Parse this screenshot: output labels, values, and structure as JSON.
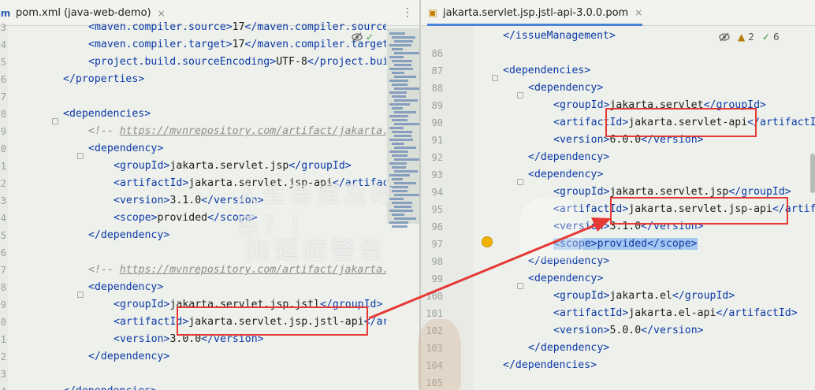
{
  "left_tab": {
    "title": "pom.xml (java-web-demo)",
    "icon": "maven-file-icon",
    "close_label": "×"
  },
  "right_tab": {
    "title": "jakarta.servlet.jsp.jstl-api-3.0.0.pom",
    "icon": "xml-file-icon",
    "close_label": "×"
  },
  "menu_dots": "⋮",
  "left_inspection": {
    "check_icon": "✓",
    "hide_icon": "hide-eye-icon"
  },
  "right_inspection": {
    "warnings": "2",
    "weak_warnings": "6"
  },
  "left_code": [
    {
      "n": "3",
      "segs": [
        [
          "tg",
          "<maven.compiler.source>"
        ],
        [
          "t",
          "17"
        ],
        [
          "tg",
          "</maven.compiler.source>"
        ]
      ]
    },
    {
      "n": "4",
      "segs": [
        [
          "tg",
          "<maven.compiler.target>"
        ],
        [
          "t",
          "17"
        ],
        [
          "tg",
          "</maven.compiler.target>"
        ]
      ]
    },
    {
      "n": "5",
      "segs": [
        [
          "tg",
          "<project.build.sourceEncoding>"
        ],
        [
          "t",
          "UTF-8"
        ],
        [
          "tg",
          "</project.build.sourceEncoding>"
        ]
      ]
    },
    {
      "n": "6",
      "segs": [
        [
          "tg",
          "</properties>"
        ]
      ]
    },
    {
      "n": "7",
      "segs": []
    },
    {
      "n": "8",
      "segs": [
        [
          "tg",
          "<dependencies>"
        ]
      ]
    },
    {
      "n": "9",
      "segs": [
        [
          "cm",
          "<!-- "
        ],
        [
          "cmu",
          "https://mvnrepository.com/artifact/jakarta.servlet.jsp/jakarta.servlet.jsp-api"
        ]
      ]
    },
    {
      "n": "0",
      "segs": [
        [
          "tg",
          "<dependency>"
        ]
      ]
    },
    {
      "n": "1",
      "segs": [
        [
          "tg",
          "<groupId>"
        ],
        [
          "t",
          "jakarta.servlet.jsp"
        ],
        [
          "tg",
          "</groupId>"
        ]
      ]
    },
    {
      "n": "2",
      "segs": [
        [
          "tg",
          "<artifactId>"
        ],
        [
          "t",
          "jakarta.servlet.jsp-api"
        ],
        [
          "tg",
          "</artifactId>"
        ]
      ]
    },
    {
      "n": "3",
      "segs": [
        [
          "tg",
          "<version>"
        ],
        [
          "t",
          "3.1.0"
        ],
        [
          "tg",
          "</version>"
        ]
      ]
    },
    {
      "n": "4",
      "segs": [
        [
          "tg",
          "<scope>"
        ],
        [
          "t",
          "provided"
        ],
        [
          "tg",
          "</scope>"
        ]
      ]
    },
    {
      "n": "5",
      "segs": [
        [
          "tg",
          "</dependency>"
        ]
      ]
    },
    {
      "n": "6",
      "segs": []
    },
    {
      "n": "7",
      "segs": [
        [
          "cm",
          "<!-- "
        ],
        [
          "cmu",
          "https://mvnrepository.com/artifact/jakarta.servlet.jsp.jstl/jakarta.servlet.jsp.jstl-api"
        ]
      ]
    },
    {
      "n": "8",
      "segs": [
        [
          "tg",
          "<dependency>"
        ]
      ]
    },
    {
      "n": "9",
      "segs": [
        [
          "tg",
          "<groupId>"
        ],
        [
          "t",
          "jakarta.servlet.jsp.jstl"
        ],
        [
          "tg",
          "</groupId>"
        ]
      ]
    },
    {
      "n": "0",
      "segs": [
        [
          "tg",
          "<artifactId>"
        ],
        [
          "t",
          "jakarta.servlet.jsp.jstl-api"
        ],
        [
          "tg",
          "</artifactId>"
        ]
      ]
    },
    {
      "n": "1",
      "segs": [
        [
          "tg",
          "<version>"
        ],
        [
          "t",
          "3.0.0"
        ],
        [
          "tg",
          "</version>"
        ]
      ]
    },
    {
      "n": "2",
      "segs": [
        [
          "tg",
          "</dependency>"
        ]
      ]
    },
    {
      "n": "3",
      "segs": []
    },
    {
      "n": "4",
      "segs": [
        [
          "tg",
          "</dependencies>"
        ]
      ]
    }
  ],
  "right_code": [
    {
      "n": "",
      "segs": [
        [
          "tg",
          "</issueManagement>"
        ]
      ]
    },
    {
      "n": "86",
      "segs": []
    },
    {
      "n": "87",
      "segs": [
        [
          "tg",
          "<dependencies>"
        ]
      ]
    },
    {
      "n": "88",
      "segs": [
        [
          "tg",
          "<dependency>"
        ]
      ]
    },
    {
      "n": "89",
      "segs": [
        [
          "tg",
          "<groupId>"
        ],
        [
          "t",
          "jakarta.servlet"
        ],
        [
          "tg",
          "</groupId>"
        ]
      ]
    },
    {
      "n": "90",
      "segs": [
        [
          "tg",
          "<artifactId>"
        ],
        [
          "t",
          "jakarta.servlet-api"
        ],
        [
          "tg",
          "</artifactId>"
        ]
      ]
    },
    {
      "n": "91",
      "segs": [
        [
          "tg",
          "<version>"
        ],
        [
          "t",
          "6.0.0"
        ],
        [
          "tg",
          "</version>"
        ]
      ]
    },
    {
      "n": "92",
      "segs": [
        [
          "tg",
          "</dependency>"
        ]
      ]
    },
    {
      "n": "93",
      "segs": [
        [
          "tg",
          "<dependency>"
        ]
      ]
    },
    {
      "n": "94",
      "segs": [
        [
          "tg",
          "<groupId>"
        ],
        [
          "t",
          "jakarta.servlet.jsp"
        ],
        [
          "tg",
          "</groupId>"
        ]
      ]
    },
    {
      "n": "95",
      "segs": [
        [
          "tg",
          "<artifactId>"
        ],
        [
          "t",
          "jakarta.servlet.jsp-api"
        ],
        [
          "tg",
          "</artifactId>"
        ]
      ]
    },
    {
      "n": "96",
      "segs": [
        [
          "tg",
          "<version>"
        ],
        [
          "t",
          "3.1.0"
        ],
        [
          "tg",
          "</version>"
        ]
      ]
    },
    {
      "n": "97",
      "segs": [
        [
          "sel",
          "<scope>provided</scope>"
        ]
      ]
    },
    {
      "n": "98",
      "segs": [
        [
          "tg",
          "</dependency>"
        ]
      ]
    },
    {
      "n": "99",
      "segs": [
        [
          "tg",
          "<dependency>"
        ]
      ]
    },
    {
      "n": "100",
      "segs": [
        [
          "tg",
          "<groupId>"
        ],
        [
          "t",
          "jakarta.el"
        ],
        [
          "tg",
          "</groupId>"
        ]
      ]
    },
    {
      "n": "101",
      "segs": [
        [
          "tg",
          "<artifactId>"
        ],
        [
          "t",
          "jakarta.el-api"
        ],
        [
          "tg",
          "</artifactId>"
        ]
      ]
    },
    {
      "n": "102",
      "segs": [
        [
          "tg",
          "<version>"
        ],
        [
          "t",
          "5.0.0"
        ],
        [
          "tg",
          "</version>"
        ]
      ]
    },
    {
      "n": "103",
      "segs": [
        [
          "tg",
          "</dependency>"
        ]
      ]
    },
    {
      "n": "104",
      "segs": [
        [
          "tg",
          "</dependencies>"
        ]
      ]
    },
    {
      "n": "105",
      "segs": []
    }
  ],
  "watermark": {
    "line1": "人生苦短及时乐？！",
    "line2": "拖延症警告"
  },
  "annotation_color": "#e53935"
}
